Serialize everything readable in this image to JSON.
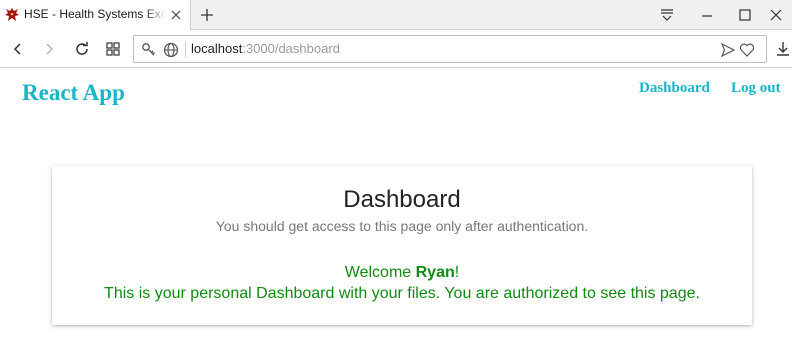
{
  "browser": {
    "tab": {
      "title": "HSE - Health Systems Exchange",
      "favicon": "dragon-favicon-icon"
    },
    "address": {
      "host": "localhost",
      "path": ":3000/dashboard"
    },
    "icons": {
      "back": "back-arrow-icon",
      "forward": "forward-arrow-icon",
      "reload": "reload-icon",
      "speed_dial": "grid-icon",
      "key": "key-icon",
      "globe": "globe-icon",
      "send": "send-icon",
      "bookmark": "heart-icon",
      "download": "download-icon",
      "menu": "tab-menu-icon",
      "minimize": "minimize-icon",
      "maximize": "maximize-icon",
      "close": "close-window-icon"
    }
  },
  "app": {
    "brand": "React App",
    "nav": {
      "dashboard": "Dashboard",
      "logout": "Log out"
    },
    "colors": {
      "accent": "#19b5c8",
      "success": "#118a11"
    }
  },
  "dashboard": {
    "title": "Dashboard",
    "subtitle": "You should get access to this page only after authentication.",
    "welcome_prefix": "Welcome ",
    "username": "Ryan",
    "welcome_suffix": "!",
    "message": "This is your personal Dashboard with your files. You are authorized to see this page."
  }
}
